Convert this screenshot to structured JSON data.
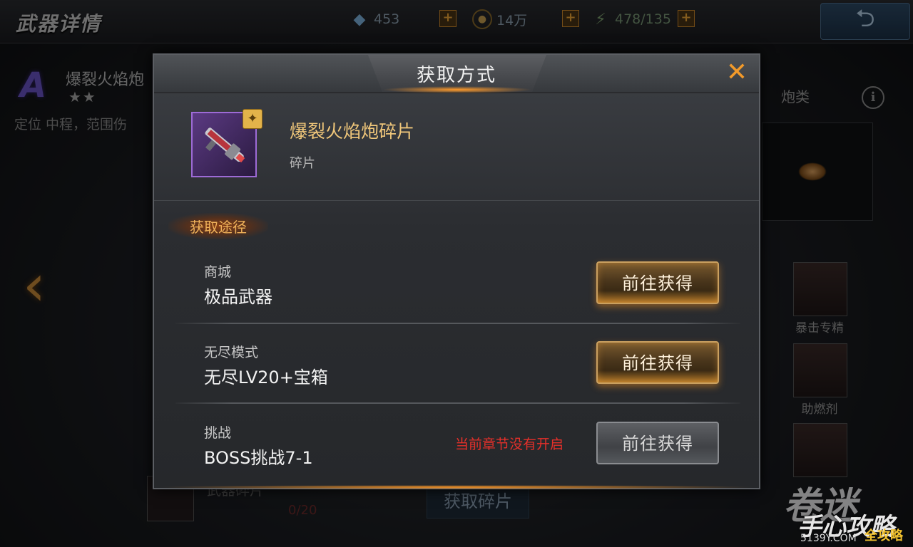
{
  "topbar": {
    "title": "武器详情",
    "diamonds": "453",
    "gold": "14万",
    "energy": "478/135",
    "plus": "+",
    "back_icon": "back-arrow-icon"
  },
  "weapon": {
    "grade": "A",
    "name": "爆裂火焰炮",
    "stars": "★★",
    "role": "定位  中程，范围伤",
    "category": "炮类"
  },
  "side_skills": [
    {
      "label": "暴击专精"
    },
    {
      "label": "助燃剂"
    }
  ],
  "bottom": {
    "fragment_label": "武器碎片",
    "fragment_count": "0/20",
    "get_fragment_button": "获取碎片"
  },
  "watermark": {
    "big": "卷迷",
    "brand": "手心攻略",
    "url": "5139Y.COM",
    "sub": "全攻略"
  },
  "modal": {
    "title": "获取方式",
    "close": "✕",
    "item": {
      "name": "爆裂火焰炮碎片",
      "type": "碎片"
    },
    "section_label": "获取途径",
    "routes": [
      {
        "category": "商城",
        "name": "极品武器",
        "button": "前往获得",
        "enabled": true,
        "note": ""
      },
      {
        "category": "无尽模式",
        "name": "无尽LV20+宝箱",
        "button": "前往获得",
        "enabled": true,
        "note": ""
      },
      {
        "category": "挑战",
        "name": "BOSS挑战7-1",
        "button": "前往获得",
        "enabled": false,
        "note": "当前章节没有开启"
      }
    ]
  },
  "colors": {
    "accent_orange": "#f29a2a",
    "item_name": "#f0c77a",
    "locked_red": "#e5302a",
    "rare_purple": "#9d6bd6"
  }
}
